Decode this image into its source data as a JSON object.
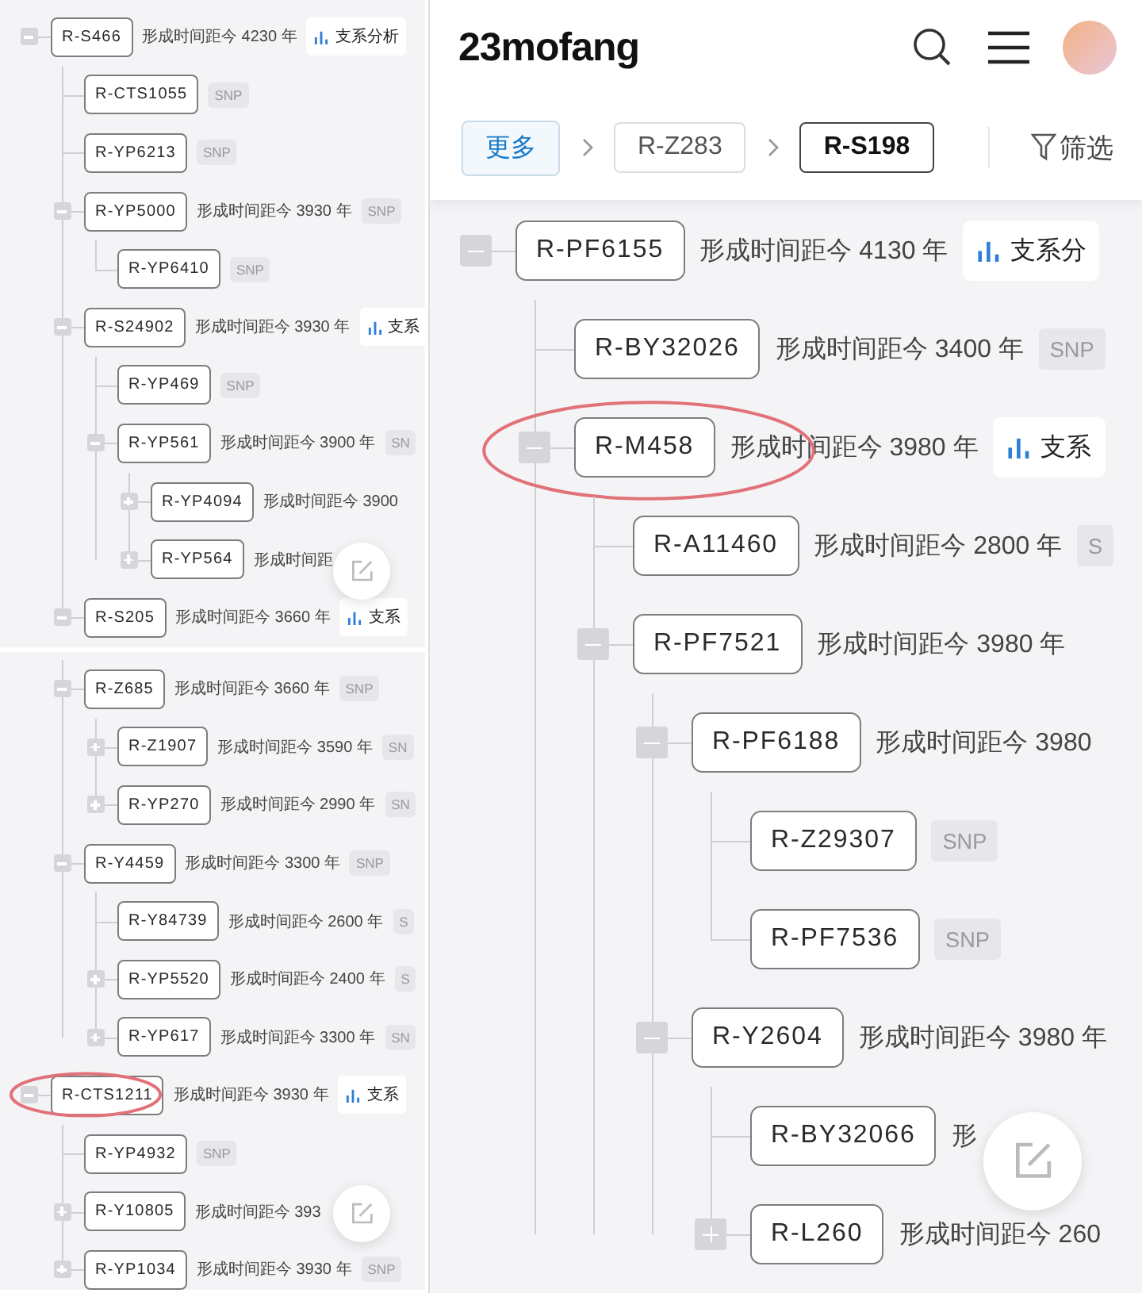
{
  "panels": [
    {
      "kind": "cropped",
      "edit_button": true,
      "nodes": [
        {
          "label": "R-S466",
          "age": "形成时间距今 4230 年",
          "expanded": true,
          "tag": {
            "kind": "analysis",
            "text": "支系分析"
          },
          "children": [
            {
              "label": "R-CTS1055",
              "tag": {
                "kind": "snp",
                "text": "SNP"
              }
            },
            {
              "label": "R-YP6213",
              "tag": {
                "kind": "snp",
                "text": "SNP"
              }
            },
            {
              "label": "R-YP5000",
              "age": "形成时间距今 3930 年",
              "expanded": true,
              "tag": {
                "kind": "snp",
                "text": "SNP"
              },
              "children": [
                {
                  "label": "R-YP6410",
                  "tag": {
                    "kind": "snp",
                    "text": "SNP"
                  }
                }
              ]
            },
            {
              "label": "R-S24902",
              "age": "形成时间距今 3930 年",
              "expanded": true,
              "tag": {
                "kind": "analysis",
                "text": "支系"
              },
              "children": [
                {
                  "label": "R-YP469",
                  "tag": {
                    "kind": "snp",
                    "text": "SNP"
                  }
                },
                {
                  "label": "R-YP561",
                  "age": "形成时间距今 3900 年",
                  "expanded": true,
                  "tag": {
                    "kind": "snp",
                    "text": "SN"
                  },
                  "children": [
                    {
                      "label": "R-YP4094",
                      "age": "形成时间距今 3900",
                      "expanded": false
                    },
                    {
                      "label": "R-YP564",
                      "age": "形成时间距",
                      "expanded": false
                    }
                  ]
                }
              ]
            },
            {
              "label": "R-S205",
              "age": "形成时间距今 3660 年",
              "expanded": true,
              "tag": {
                "kind": "analysis",
                "text": "支系"
              }
            }
          ]
        }
      ]
    },
    {
      "kind": "cropped",
      "edit_button": true,
      "nodes": [
        {
          "circled": false,
          "children": [
            {
              "label": "R-Z685",
              "age": "形成时间距今 3660 年",
              "expanded": true,
              "tag": {
                "kind": "snp",
                "text": "SNP"
              },
              "children": [
                {
                  "label": "R-Z1907",
                  "age": "形成时间距今 3590 年",
                  "expanded": false,
                  "tag": {
                    "kind": "snp",
                    "text": "SN"
                  }
                },
                {
                  "label": "R-YP270",
                  "age": "形成时间距今 2990 年",
                  "expanded": false,
                  "tag": {
                    "kind": "snp",
                    "text": "SN"
                  }
                }
              ]
            },
            {
              "label": "R-Y4459",
              "age": "形成时间距今 3300 年",
              "expanded": true,
              "tag": {
                "kind": "snp",
                "text": "SNP"
              },
              "children": [
                {
                  "label": "R-Y84739",
                  "age": "形成时间距今 2600 年",
                  "tag": {
                    "kind": "snp",
                    "text": "S"
                  }
                },
                {
                  "label": "R-YP5520",
                  "age": "形成时间距今 2400 年",
                  "expanded": false,
                  "tag": {
                    "kind": "snp",
                    "text": "S"
                  }
                },
                {
                  "label": "R-YP617",
                  "age": "形成时间距今 3300 年",
                  "expanded": false,
                  "tag": {
                    "kind": "snp",
                    "text": "SN"
                  }
                }
              ]
            }
          ]
        },
        {
          "label": "R-CTS1211",
          "age": "形成时间距今 3930 年",
          "expanded": true,
          "circled": true,
          "tag": {
            "kind": "analysis",
            "text": "支系"
          },
          "children": [
            {
              "label": "R-YP4932",
              "tag": {
                "kind": "snp",
                "text": "SNP"
              }
            },
            {
              "label": "R-Y10805",
              "age": "形成时间距今 393",
              "expanded": false
            },
            {
              "label": "R-YP1034",
              "age": "形成时间距今 3930 年",
              "expanded": false,
              "tag": {
                "kind": "snp",
                "text": "SNP"
              }
            }
          ]
        }
      ]
    },
    {
      "kind": "full",
      "edit_button": true,
      "header": {
        "logo": "23mofang"
      },
      "breadcrumb": [
        {
          "label": "更多",
          "kind": "more",
          "selected": false
        },
        {
          "label": "R-Z283",
          "kind": "crumb",
          "selected": false
        },
        {
          "label": "R-S198",
          "kind": "crumb",
          "selected": true
        }
      ],
      "filter": "筛选",
      "nodes": [
        {
          "label": "R-PF6155",
          "age": "形成时间距今 4130 年",
          "expanded": true,
          "tag": {
            "kind": "analysis",
            "text": "支系分"
          },
          "children": [
            {
              "label": "R-BY32026",
              "age": "形成时间距今 3400 年",
              "circled": false,
              "tag": {
                "kind": "snp",
                "text": "SNP"
              }
            },
            {
              "label": "R-M458",
              "age": "形成时间距今 3980 年",
              "expanded": true,
              "circled": true,
              "tag": {
                "kind": "analysis",
                "text": "支系"
              },
              "children": [
                {
                  "label": "R-A11460",
                  "age": "形成时间距今 2800 年",
                  "tag": {
                    "kind": "snp",
                    "text": "S"
                  }
                },
                {
                  "label": "R-PF7521",
                  "age": "形成时间距今 3980 年",
                  "expanded": true,
                  "children": [
                    {
                      "label": "R-PF6188",
                      "age": "形成时间距今 3980",
                      "expanded": true,
                      "children": [
                        {
                          "label": "R-Z29307",
                          "tag": {
                            "kind": "snp",
                            "text": "SNP"
                          }
                        },
                        {
                          "label": "R-PF7536",
                          "tag": {
                            "kind": "snp",
                            "text": "SNP"
                          }
                        }
                      ]
                    },
                    {
                      "label": "R-Y2604",
                      "age": "形成时间距今 3980 年",
                      "expanded": true,
                      "children": [
                        {
                          "label": "R-BY32066",
                          "age": "形"
                        },
                        {
                          "label": "R-L260",
                          "age": "形成时间距今 260",
                          "expanded": false
                        }
                      ]
                    }
                  ]
                }
              ]
            }
          ]
        }
      ]
    }
  ]
}
